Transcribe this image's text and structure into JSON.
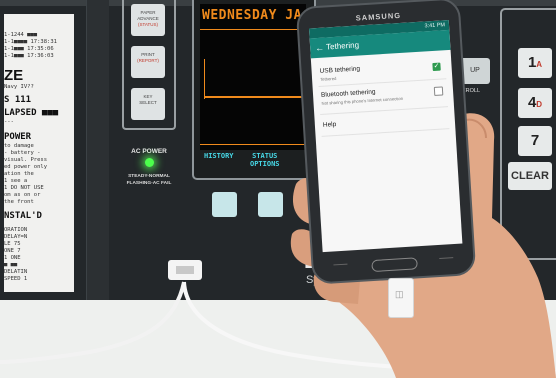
{
  "panel": {
    "receipt_lines": [
      "1-1244 ■■■",
      "1-1■■■■ 17:38:31",
      "1-1■■■ 17:35:06",
      "1-1■■■ 17:36:03"
    ],
    "receipt_brand": "ZE",
    "receipt_brand_sub": "Navy IV??",
    "receipt_line_111": "S  111",
    "receipt_lapsed": "LAPSED ■■■",
    "receipt_phone": "---",
    "receipt_power": "POWER",
    "receipt_notice": [
      "to damage",
      "- battery -",
      "visual. Press",
      "ed power only",
      "ation the",
      "1 see a",
      "1 DO NOT USE",
      "om as on or",
      "the front"
    ],
    "receipt_install": "NSTAL'D",
    "receipt_footer": [
      "ORATION",
      "DELAY=N",
      "LE 75",
      "ONE 7",
      "1 ONE",
      "■ ■■",
      "DELATIN",
      "SPEED 1"
    ],
    "buttons": [
      {
        "line1": "PAPER",
        "line2": "ADVANCE",
        "line3": "(STATUS)"
      },
      {
        "line1": "PRINT",
        "line2": "(REPORT)",
        "line3": ""
      },
      {
        "line1": "KEY",
        "line2": "SELECT",
        "line3": ""
      }
    ],
    "ac_power_label": "AC POWER",
    "ac_power_note": [
      "STEADY-NORMAL",
      "FLASHING-AC FAIL"
    ],
    "screen_header": "WEDNESDAY JA",
    "softkey_history": "HISTORY",
    "softkey_status": [
      "STATUS",
      "OPTIONS"
    ],
    "scroll_label": "SCROLL",
    "scroll_key": "UP",
    "brand_partial": "DI",
    "brand_sub_partial": "Sys",
    "keypad": [
      {
        "num": "1",
        "sub": "A"
      },
      {
        "num": "4",
        "sub": "D"
      },
      {
        "num": "7",
        "sub": ""
      }
    ],
    "clear_key": "CLEAR"
  },
  "phone": {
    "brand": "SAMSUNG",
    "status_time": "3:41 PM",
    "app_title": "Tethering",
    "settings": [
      {
        "title": "USB tethering",
        "sub": "Tethered",
        "checked": true
      },
      {
        "title": "Bluetooth tethering",
        "sub": "Not sharing this phone's Internet connection",
        "checked": false
      },
      {
        "title": "Help",
        "sub": "",
        "checked": null
      }
    ],
    "icons": {
      "back": "arrow-left-icon",
      "check": "checkbox-checked-icon"
    }
  },
  "colors": {
    "screen_text": "#f08a1c",
    "softkey_text": "#47d7e6",
    "led": "#4cff4c",
    "app_bar": "#16897d",
    "status_bar": "#0e6b62",
    "checkbox": "#2e9a4f"
  }
}
